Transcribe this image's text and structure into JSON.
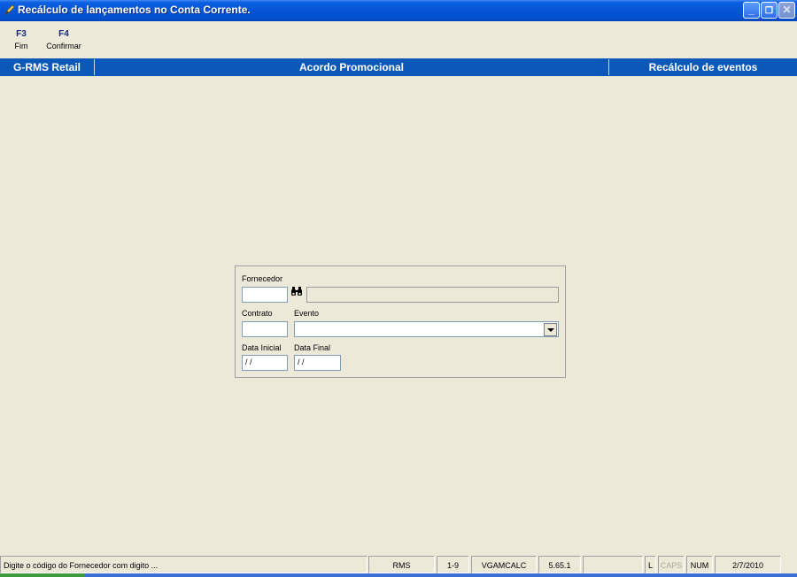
{
  "window": {
    "title": "Recálculo de lançamentos no Conta Corrente.",
    "controls": {
      "minimize": "_",
      "restore": "❐",
      "close": "✕"
    }
  },
  "toolbar": {
    "items": [
      {
        "key": "F3",
        "label": "Fim"
      },
      {
        "key": "F4",
        "label": "Confirmar"
      }
    ]
  },
  "header": {
    "left": "G-RMS Retail",
    "center": "Acordo Promocional",
    "right": "Recálculo de eventos",
    "background": "#0A58B8"
  },
  "form": {
    "fornecedor_label": "Fornecedor",
    "fornecedor_code": "",
    "fornecedor_name": "",
    "contrato_label": "Contrato",
    "contrato_value": "",
    "evento_label": "Evento",
    "evento_value": "",
    "data_inicial_label": "Data Inicial",
    "data_inicial_value": " / /",
    "data_final_label": "Data Final",
    "data_final_value": " / /"
  },
  "statusbar": {
    "message": "Digite o código do Fornecedor com digito ...",
    "cells": [
      "RMS",
      "1-9",
      "VGAMCALC",
      "5.65.1",
      ""
    ],
    "indicators": {
      "l": "L",
      "caps": "CAPS",
      "num": "NUM"
    },
    "date": "2/7/2010"
  },
  "icons": {
    "app": "pen-icon",
    "find": "binoculars-icon",
    "dropdown": "chevron-down-icon"
  }
}
